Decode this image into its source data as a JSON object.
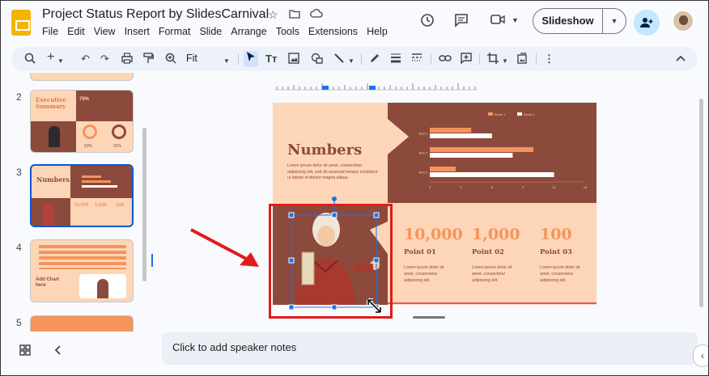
{
  "header": {
    "title": "Project Status Report by SlidesCarnival",
    "menu": [
      "File",
      "Edit",
      "View",
      "Insert",
      "Format",
      "Slide",
      "Arrange",
      "Tools",
      "Extensions",
      "Help"
    ],
    "slideshow_label": "Slideshow"
  },
  "toolbar": {
    "zoom": "Fit"
  },
  "filmstrip": {
    "slides": [
      {
        "number": "2",
        "title": "Executive Summary",
        "stats": [
          "79%",
          "53%",
          "22%"
        ]
      },
      {
        "number": "3",
        "title": "Numbers",
        "stats": [
          "10,000",
          "1,000",
          "100"
        ]
      },
      {
        "number": "4",
        "title": "Add Chart here"
      },
      {
        "number": "5"
      }
    ]
  },
  "slide": {
    "title": "Numbers",
    "body": "Lorem ipsum dolor sit amet, consectetur adipiscing elit, sed do eiusmod tempor incididunt ut labore et dolore magna aliqua.",
    "stats": [
      {
        "value": "10,000",
        "label": "Point 01",
        "text": "Lorem ipsum dolor sit amet, consectetur adipiscing elit."
      },
      {
        "value": "1,000",
        "label": "Point 02",
        "text": "Lorem ipsum dolor sit amet, consectetur adipiscing elit."
      },
      {
        "value": "100",
        "label": "Point 03",
        "text": "Lorem ipsum dolor sit amet, consectetur adipiscing elit."
      }
    ],
    "chart": {
      "legend": [
        "Series 1",
        "Series 2"
      ],
      "categories": [
        "Item 1",
        "Item 2",
        "Item 3"
      ],
      "ticks": [
        "0",
        "3",
        "6",
        "9",
        "12",
        "15"
      ]
    }
  },
  "chart_data": {
    "type": "bar",
    "categories": [
      "Item 1",
      "Item 2",
      "Item 3"
    ],
    "series": [
      {
        "name": "Series 1",
        "values": [
          4,
          10,
          2.5
        ]
      },
      {
        "name": "Series 2",
        "values": [
          6,
          8,
          12
        ]
      }
    ],
    "xlim": [
      0,
      15
    ]
  },
  "notes": {
    "placeholder": "Click to add speaker notes"
  },
  "colors": {
    "slide_bg": "#fdd6b8",
    "brown": "#8c4a3c",
    "orange": "#f5945c",
    "highlight_box": "#e01b1b",
    "selection_blue": "#1a73e8"
  }
}
